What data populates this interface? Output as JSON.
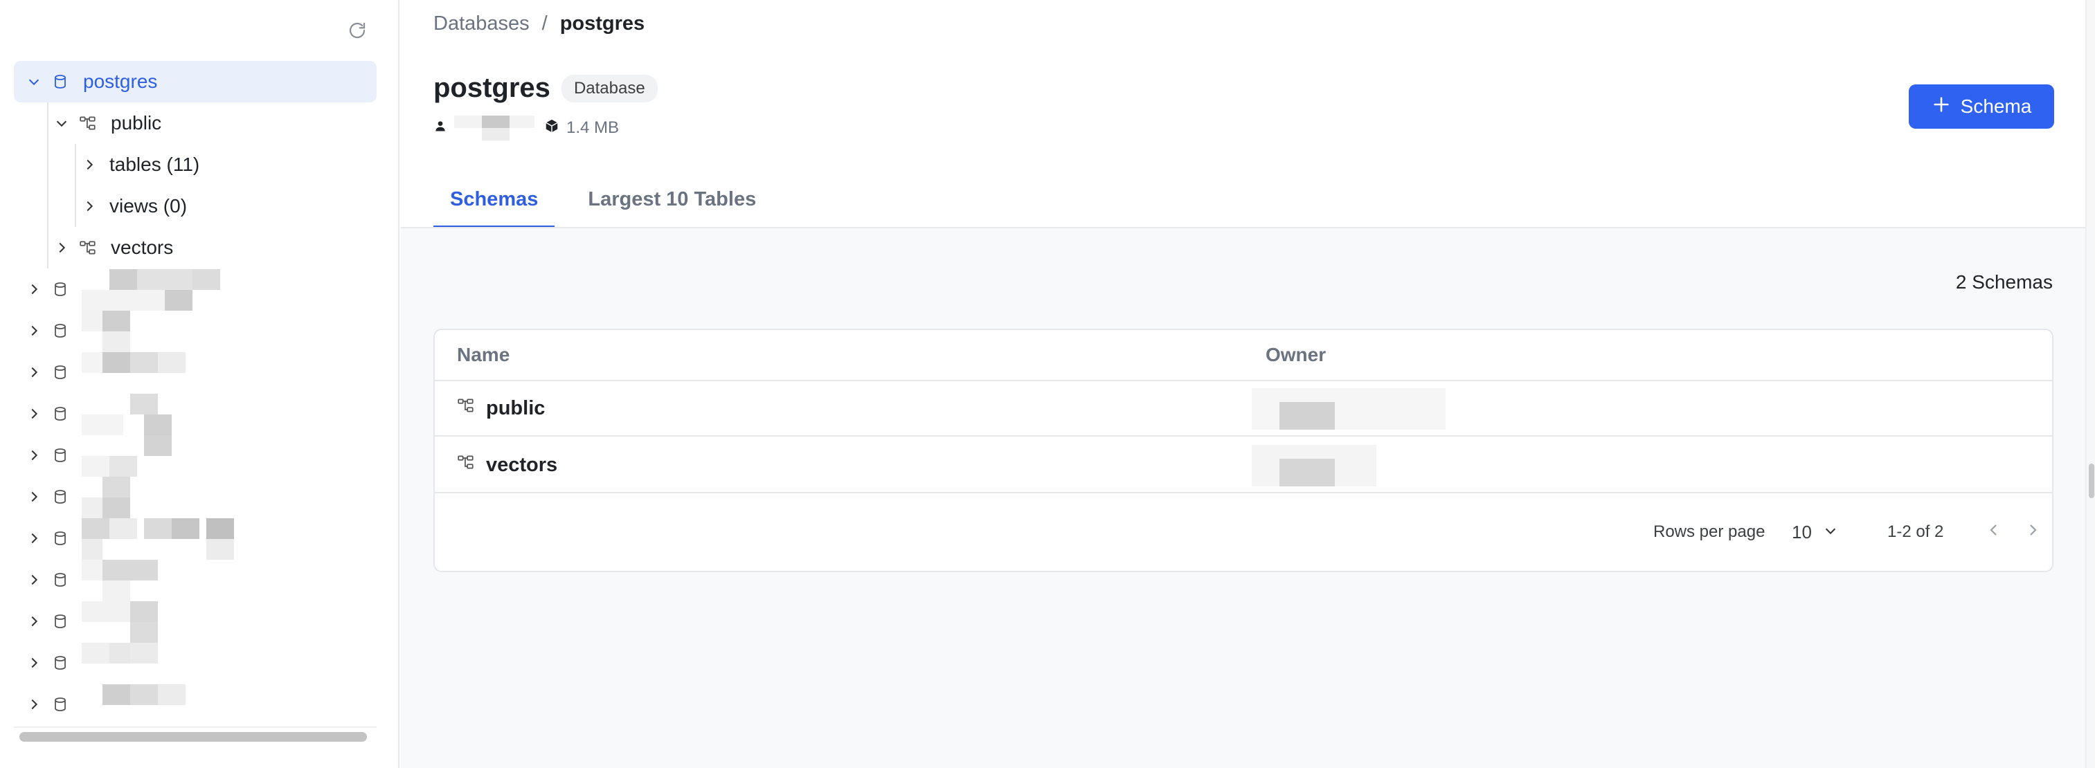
{
  "sidebar": {
    "tree": [
      {
        "label": "postgres",
        "icon": "database-icon",
        "expanded": true,
        "selected": true
      },
      {
        "label": "public",
        "icon": "schema-icon",
        "expanded": true
      },
      {
        "label": "tables (11)"
      },
      {
        "label": "views (0)"
      },
      {
        "label": "vectors",
        "icon": "schema-icon",
        "expanded": false
      }
    ]
  },
  "breadcrumb": {
    "root": "Databases",
    "separator": "/",
    "current": "postgres"
  },
  "header": {
    "title": "postgres",
    "badge": "Database",
    "size": "1.4 MB"
  },
  "actions": {
    "add_schema_label": "Schema"
  },
  "tabs": [
    {
      "label": "Schemas"
    },
    {
      "label": "Largest 10 Tables"
    }
  ],
  "schemas": {
    "count_label": "2 Schemas",
    "columns": {
      "name": "Name",
      "owner": "Owner"
    },
    "rows": [
      {
        "name": "public"
      },
      {
        "name": "vectors"
      }
    ],
    "pagination": {
      "rows_per_page_label": "Rows per page",
      "rows_per_page": "10",
      "range": "1-2 of 2"
    }
  },
  "colors": {
    "accent": "#2f62f0",
    "selected_bg": "#e9f0fc",
    "panel_bg": "#f8f9fb"
  }
}
